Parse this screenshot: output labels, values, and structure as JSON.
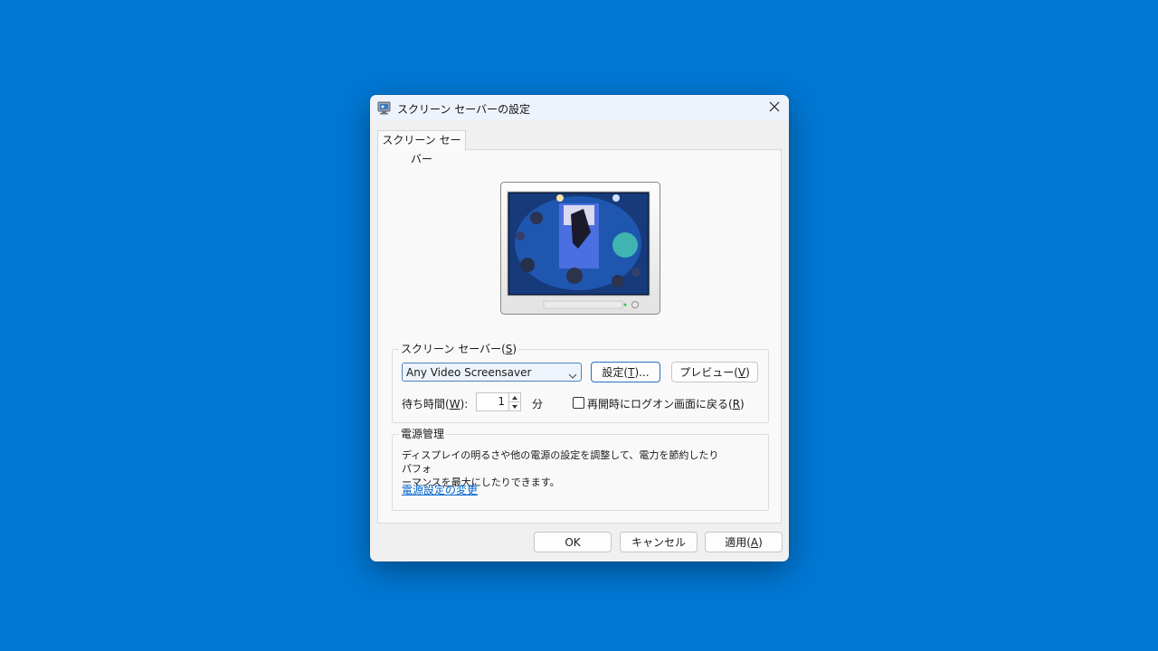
{
  "window": {
    "title": "スクリーン セーバーの設定",
    "icon": "screensaver-monitor-icon"
  },
  "tab": {
    "label": "スクリーン セーバー"
  },
  "screensaver_group": {
    "legend_text": "スクリーン セーバー(",
    "legend_key": "S",
    "legend_close": ")",
    "selected": "Any Video Screensaver",
    "settings_text": "設定(",
    "settings_key": "T",
    "settings_close": ")...",
    "preview_text": "プレビュー(",
    "preview_key": "V",
    "preview_close": ")",
    "wait_text": "待ち時間(",
    "wait_key": "W",
    "wait_close": "):",
    "wait_value": "1",
    "wait_unit": "分",
    "resume_text": "再開時にログオン画面に戻る(",
    "resume_key": "R",
    "resume_close": ")",
    "resume_checked": false
  },
  "power_group": {
    "legend": "電源管理",
    "desc_line1": "ディスプレイの明るさや他の電源の設定を調整して、電力を節約したりパフォ",
    "desc_line2": "ーマンスを最大にしたりできます。",
    "link": "電源設定の変更"
  },
  "footer": {
    "ok": "OK",
    "cancel": "キャンセル",
    "apply_text": "適用(",
    "apply_key": "A",
    "apply_close": ")"
  },
  "colors": {
    "desktop": "#0078d4",
    "accent": "#2a6fc0",
    "link": "#0066cc"
  }
}
